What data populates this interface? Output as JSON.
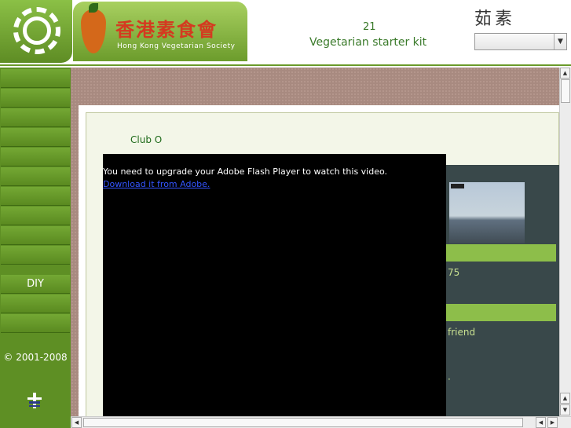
{
  "header": {
    "org_name_cn": "香港素食會",
    "org_name_en": "Hong Kong Vegetarian Society",
    "issue_number": "21",
    "issue_title": "Vegetarian starter kit",
    "calligraphy": "茹素",
    "select_value": ""
  },
  "sidebar": {
    "items": [
      "",
      "",
      "",
      "",
      "",
      "",
      "",
      "",
      "",
      "",
      "DIY",
      "",
      ""
    ],
    "copyright": "© 2001-2008"
  },
  "content": {
    "page_title": "",
    "intro_text": "Club O",
    "right_heading": ""
  },
  "flash": {
    "message": "You need to upgrade your Adobe Flash Player to watch this video.",
    "link": "Download it from Adobe."
  },
  "right_col": {
    "webcam_label": "",
    "band1": "",
    "line1": "75",
    "line2": "",
    "band2": "",
    "links": [
      "friend",
      "",
      "",
      "·",
      "",
      ""
    ]
  },
  "colors": {
    "brand_green": "#5e8f24",
    "accent_green": "#8dbe4a",
    "title_green": "#1e6a1a"
  }
}
